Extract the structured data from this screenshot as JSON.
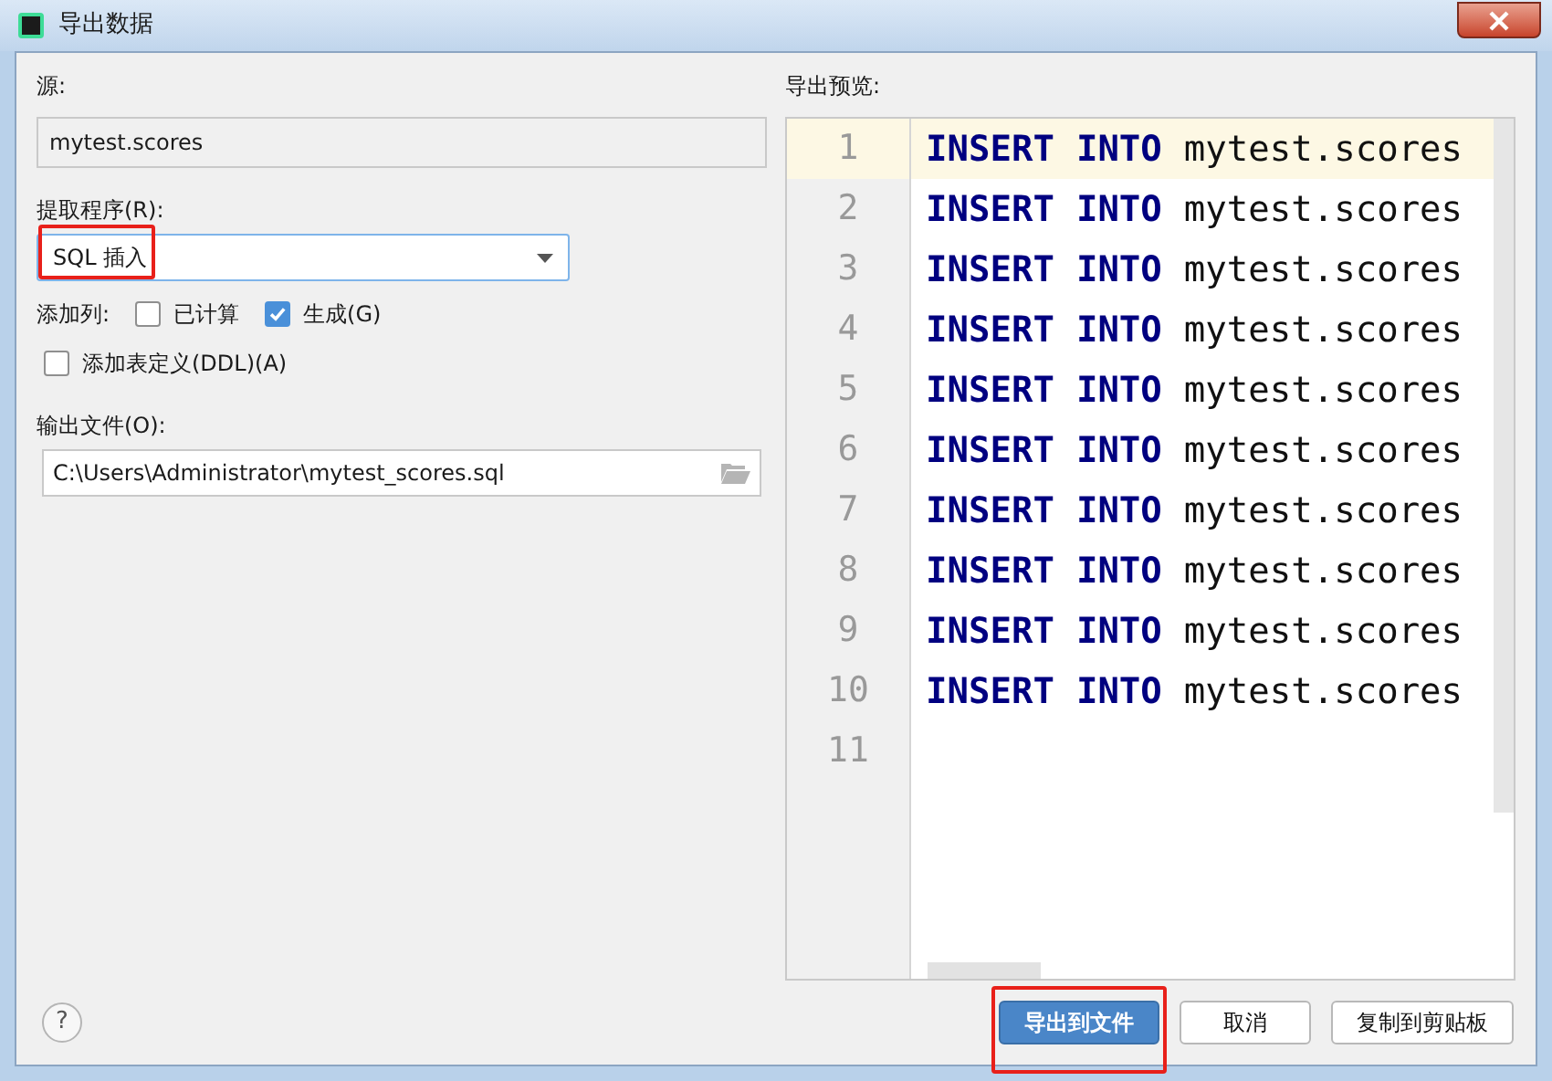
{
  "window": {
    "title": "导出数据"
  },
  "source": {
    "label": "源:",
    "value": "mytest.scores"
  },
  "extractor": {
    "label": "提取程序(R):",
    "value": "SQL 插入",
    "annotated": true
  },
  "add_columns": {
    "label": "添加列:",
    "options": [
      {
        "label": "已计算",
        "checked": false
      },
      {
        "label": "生成(G)",
        "checked": true
      }
    ]
  },
  "add_ddl": {
    "label": "添加表定义(DDL)(A)",
    "checked": false
  },
  "output_file": {
    "label": "输出文件(O):",
    "value": "C:\\Users\\Administrator\\mytest_scores.sql"
  },
  "preview": {
    "label": "导出预览:",
    "lines": [
      {
        "number": "1",
        "tokens": [
          "INSERT",
          "INTO",
          "mytest.scores"
        ],
        "selected": true
      },
      {
        "number": "2",
        "tokens": [
          "INSERT",
          "INTO",
          "mytest.scores"
        ],
        "selected": false
      },
      {
        "number": "3",
        "tokens": [
          "INSERT",
          "INTO",
          "mytest.scores"
        ],
        "selected": false
      },
      {
        "number": "4",
        "tokens": [
          "INSERT",
          "INTO",
          "mytest.scores"
        ],
        "selected": false
      },
      {
        "number": "5",
        "tokens": [
          "INSERT",
          "INTO",
          "mytest.scores"
        ],
        "selected": false
      },
      {
        "number": "6",
        "tokens": [
          "INSERT",
          "INTO",
          "mytest.scores"
        ],
        "selected": false
      },
      {
        "number": "7",
        "tokens": [
          "INSERT",
          "INTO",
          "mytest.scores"
        ],
        "selected": false
      },
      {
        "number": "8",
        "tokens": [
          "INSERT",
          "INTO",
          "mytest.scores"
        ],
        "selected": false
      },
      {
        "number": "9",
        "tokens": [
          "INSERT",
          "INTO",
          "mytest.scores"
        ],
        "selected": false
      },
      {
        "number": "10",
        "tokens": [
          "INSERT",
          "INTO",
          "mytest.scores"
        ],
        "selected": false
      },
      {
        "number": "11",
        "selected": false
      }
    ]
  },
  "help": {
    "label": "?"
  },
  "buttons": [
    {
      "label": "导出到文件",
      "kind": "primary",
      "annotated": true
    },
    {
      "label": "取消",
      "kind": "normal",
      "annotated": false
    },
    {
      "label": "复制到剪贴板",
      "kind": "normal",
      "annotated": false
    }
  ]
}
